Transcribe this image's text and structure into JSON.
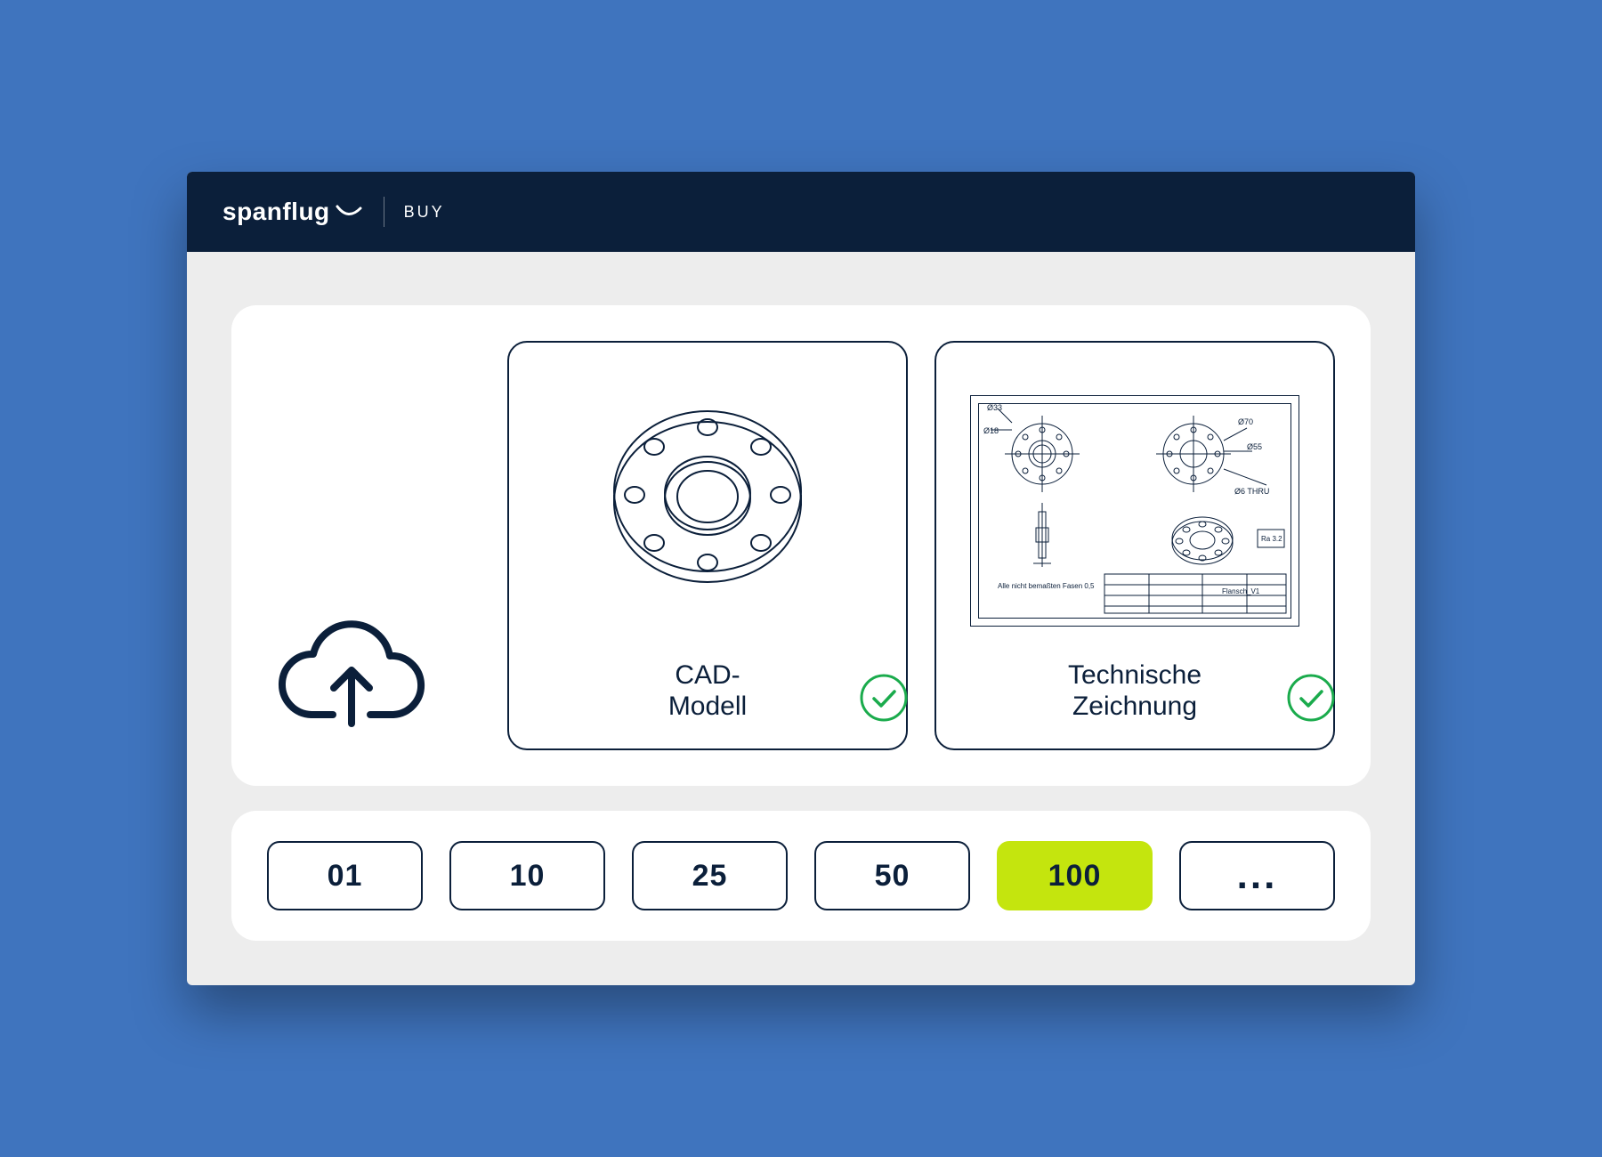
{
  "header": {
    "brand": "spanflug",
    "section": "BUY"
  },
  "upload": {
    "icon": "cloud-upload-icon"
  },
  "tiles": {
    "cad": {
      "label": "CAD-\nModell",
      "checked": true
    },
    "drawing": {
      "label": "Technische\nZeichnung",
      "checked": true
    }
  },
  "quantities": [
    {
      "label": "01",
      "selected": false
    },
    {
      "label": "10",
      "selected": false
    },
    {
      "label": "25",
      "selected": false
    },
    {
      "label": "50",
      "selected": false
    },
    {
      "label": "100",
      "selected": true
    },
    {
      "label": "...",
      "selected": false,
      "more": true
    }
  ],
  "colors": {
    "navy": "#0b1f3a",
    "accent": "#c4e50e",
    "background": "#3f74be",
    "success": "#1db954"
  }
}
